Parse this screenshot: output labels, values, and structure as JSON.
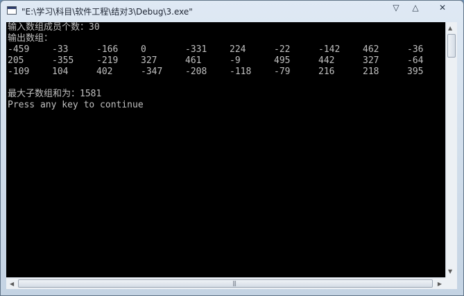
{
  "window": {
    "title": "\"E:\\学习\\科目\\软件工程\\结对3\\Debug\\3.exe\"",
    "buttons": {
      "minimize": "▽",
      "maximize": "△",
      "close": "✕"
    }
  },
  "console": {
    "prompt_line": "输入数组成员个数：30",
    "output_label": "输出数组：",
    "rows": [
      [
        "-459",
        "-33",
        "-166",
        "0",
        "-331",
        "224",
        "-22",
        "-142",
        "462",
        "-36"
      ],
      [
        "205",
        "-355",
        "-219",
        "327",
        "461",
        "-9",
        "495",
        "442",
        "327",
        "-64"
      ],
      [
        "-109",
        "104",
        "402",
        "-347",
        "-208",
        "-118",
        "-79",
        "216",
        "218",
        "395"
      ]
    ],
    "result_line": "最大子数组和为：1581",
    "continue_line": "Press any key to continue"
  },
  "scrollbars": {
    "up_arrow": "▲",
    "down_arrow": "▼",
    "left_arrow": "◀",
    "right_arrow": "▶",
    "grip": "|||"
  }
}
